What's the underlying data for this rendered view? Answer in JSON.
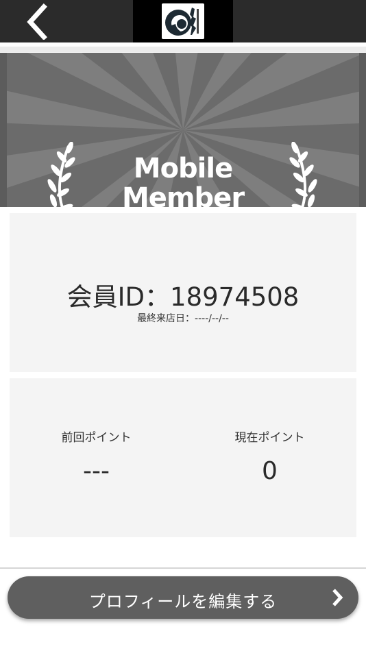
{
  "header": {
    "back_icon": "chevron-left-icon",
    "logo_icon": "wave-logo-icon"
  },
  "banner": {
    "title_line1": "Mobile",
    "title_line2": "Member",
    "laurel_icon": "laurel-branch-icon"
  },
  "member": {
    "id_text": "会員ID：18974508",
    "last_visit_text": "最終来店日：----/--/--"
  },
  "points": {
    "previous_label": "前回ポイント",
    "previous_value": "---",
    "current_label": "現在ポイント",
    "current_value": "0"
  },
  "actions": {
    "edit_profile_label": "プロフィールを編集する",
    "edit_profile_icon": "chevron-right-icon"
  },
  "colors": {
    "header_bg": "#2b2b2b",
    "banner_bg": "#6d6d6d",
    "card_bg": "#f4f4f4",
    "button_bg": "#5f5f5f"
  }
}
